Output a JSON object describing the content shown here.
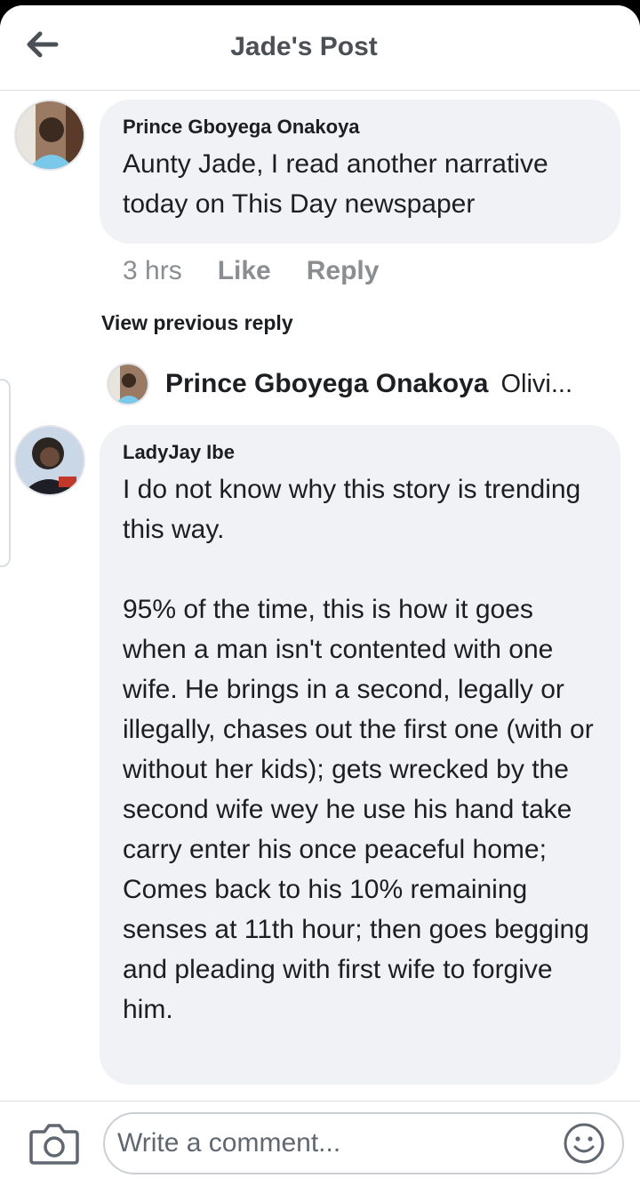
{
  "header": {
    "title": "Jade's Post",
    "back_icon": "arrow-left-icon"
  },
  "comments": [
    {
      "author": "Prince Gboyega Onakoya",
      "text": "Aunty Jade, I read another narrative today on This Day newspaper",
      "time": "3 hrs",
      "like_label": "Like",
      "reply_label": "Reply"
    },
    {
      "author": "LadyJay Ibe",
      "text": "I do not know why this story is trending this way.\n\n95% of the time, this is how it goes when a man isn't contented with one wife. He brings in a second, legally or illegally, chases out the first one (with or without her kids); gets wrecked by the second wife wey he use his hand take carry enter his once peaceful home; Comes back to his 10% remaining senses at 11th hour; then goes begging and pleading with first wife to forgive him."
    }
  ],
  "replies": {
    "view_previous_label": "View previous reply",
    "latest": {
      "author": "Prince Gboyega Onakoya",
      "preview": "Olivi..."
    }
  },
  "composer": {
    "placeholder": "Write a comment...",
    "camera_icon": "camera-icon",
    "emoji_icon": "smiley-icon"
  },
  "colors": {
    "bubble": "#f0f2f5",
    "muted_text": "#8a8d91",
    "title_text": "#4b4f56"
  }
}
